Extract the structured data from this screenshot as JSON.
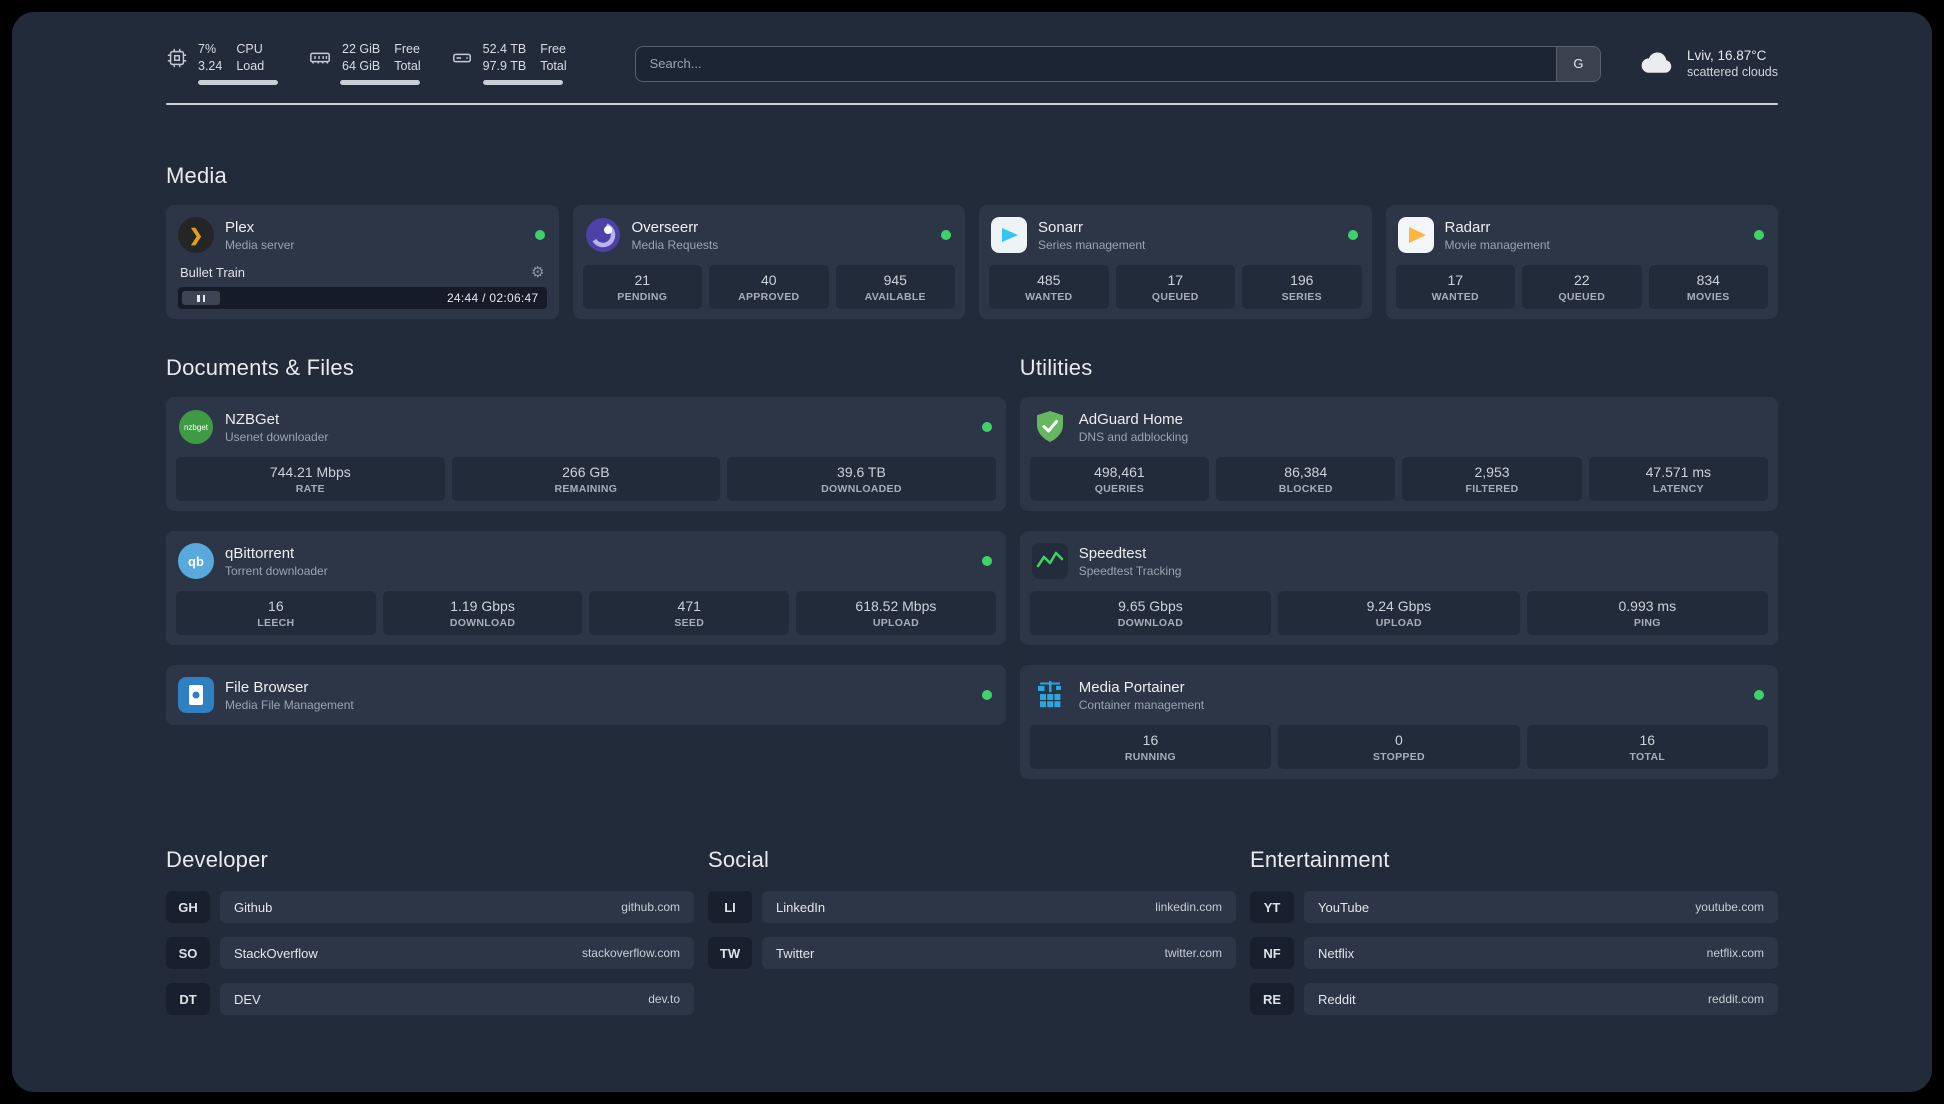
{
  "topbar": {
    "cpu": {
      "usage": "7%",
      "load": "3.24",
      "label_usage": "CPU",
      "label_load": "Load"
    },
    "memory": {
      "free": "22 GiB",
      "total": "64 GiB",
      "label_free": "Free",
      "label_total": "Total"
    },
    "disk": {
      "free": "52.4 TB",
      "total": "97.9 TB",
      "label_free": "Free",
      "label_total": "Total"
    },
    "search": {
      "placeholder": "Search...",
      "button_label": "G"
    },
    "weather": {
      "location": "Lviv, 16.87°C",
      "condition": "scattered clouds"
    }
  },
  "sections": {
    "media": "Media",
    "documents": "Documents & Files",
    "utilities": "Utilities",
    "developer": "Developer",
    "social": "Social",
    "entertainment": "Entertainment"
  },
  "services": {
    "plex": {
      "name": "Plex",
      "subtitle": "Media server",
      "now_playing": "Bullet Train",
      "time": "24:44 / 02:06:47"
    },
    "overseerr": {
      "name": "Overseerr",
      "subtitle": "Media Requests",
      "stats": [
        {
          "value": "21",
          "label": "PENDING"
        },
        {
          "value": "40",
          "label": "APPROVED"
        },
        {
          "value": "945",
          "label": "AVAILABLE"
        }
      ]
    },
    "sonarr": {
      "name": "Sonarr",
      "subtitle": "Series management",
      "stats": [
        {
          "value": "485",
          "label": "WANTED"
        },
        {
          "value": "17",
          "label": "QUEUED"
        },
        {
          "value": "196",
          "label": "SERIES"
        }
      ]
    },
    "radarr": {
      "name": "Radarr",
      "subtitle": "Movie management",
      "stats": [
        {
          "value": "17",
          "label": "WANTED"
        },
        {
          "value": "22",
          "label": "QUEUED"
        },
        {
          "value": "834",
          "label": "MOVIES"
        }
      ]
    },
    "nzbget": {
      "name": "NZBGet",
      "subtitle": "Usenet downloader",
      "stats": [
        {
          "value": "744.21 Mbps",
          "label": "RATE"
        },
        {
          "value": "266 GB",
          "label": "REMAINING"
        },
        {
          "value": "39.6 TB",
          "label": "DOWNLOADED"
        }
      ]
    },
    "qbittorrent": {
      "name": "qBittorrent",
      "subtitle": "Torrent downloader",
      "stats": [
        {
          "value": "16",
          "label": "LEECH"
        },
        {
          "value": "1.19 Gbps",
          "label": "DOWNLOAD"
        },
        {
          "value": "471",
          "label": "SEED"
        },
        {
          "value": "618.52 Mbps",
          "label": "UPLOAD"
        }
      ]
    },
    "filebrowser": {
      "name": "File Browser",
      "subtitle": "Media File Management"
    },
    "adguard": {
      "name": "AdGuard Home",
      "subtitle": "DNS and adblocking",
      "stats": [
        {
          "value": "498,461",
          "label": "QUERIES"
        },
        {
          "value": "86,384",
          "label": "BLOCKED"
        },
        {
          "value": "2,953",
          "label": "FILTERED"
        },
        {
          "value": "47.571 ms",
          "label": "LATENCY"
        }
      ]
    },
    "speedtest": {
      "name": "Speedtest",
      "subtitle": "Speedtest Tracking",
      "stats": [
        {
          "value": "9.65 Gbps",
          "label": "DOWNLOAD"
        },
        {
          "value": "9.24 Gbps",
          "label": "UPLOAD"
        },
        {
          "value": "0.993 ms",
          "label": "PING"
        }
      ]
    },
    "portainer": {
      "name": "Media Portainer",
      "subtitle": "Container management",
      "stats": [
        {
          "value": "16",
          "label": "RUNNING"
        },
        {
          "value": "0",
          "label": "STOPPED"
        },
        {
          "value": "16",
          "label": "TOTAL"
        }
      ]
    }
  },
  "bookmarks": {
    "developer": [
      {
        "abbr": "GH",
        "name": "Github",
        "url": "github.com"
      },
      {
        "abbr": "SO",
        "name": "StackOverflow",
        "url": "stackoverflow.com"
      },
      {
        "abbr": "DT",
        "name": "DEV",
        "url": "dev.to"
      }
    ],
    "social": [
      {
        "abbr": "LI",
        "name": "LinkedIn",
        "url": "linkedin.com"
      },
      {
        "abbr": "TW",
        "name": "Twitter",
        "url": "twitter.com"
      }
    ],
    "entertainment": [
      {
        "abbr": "YT",
        "name": "YouTube",
        "url": "youtube.com"
      },
      {
        "abbr": "NF",
        "name": "Netflix",
        "url": "netflix.com"
      },
      {
        "abbr": "RE",
        "name": "Reddit",
        "url": "reddit.com"
      }
    ]
  },
  "icons": {
    "gear": "⚙",
    "plex_chevron": "❯",
    "qbittorrent_text": "qb",
    "nzbget_text": "nzbget"
  },
  "colors": {
    "status_online": "#3ed36a",
    "panel_bg": "#212b3a",
    "card_bg": "#2c3646",
    "tile_bg": "#212b3a",
    "plex_amber": "#e5a00d"
  }
}
